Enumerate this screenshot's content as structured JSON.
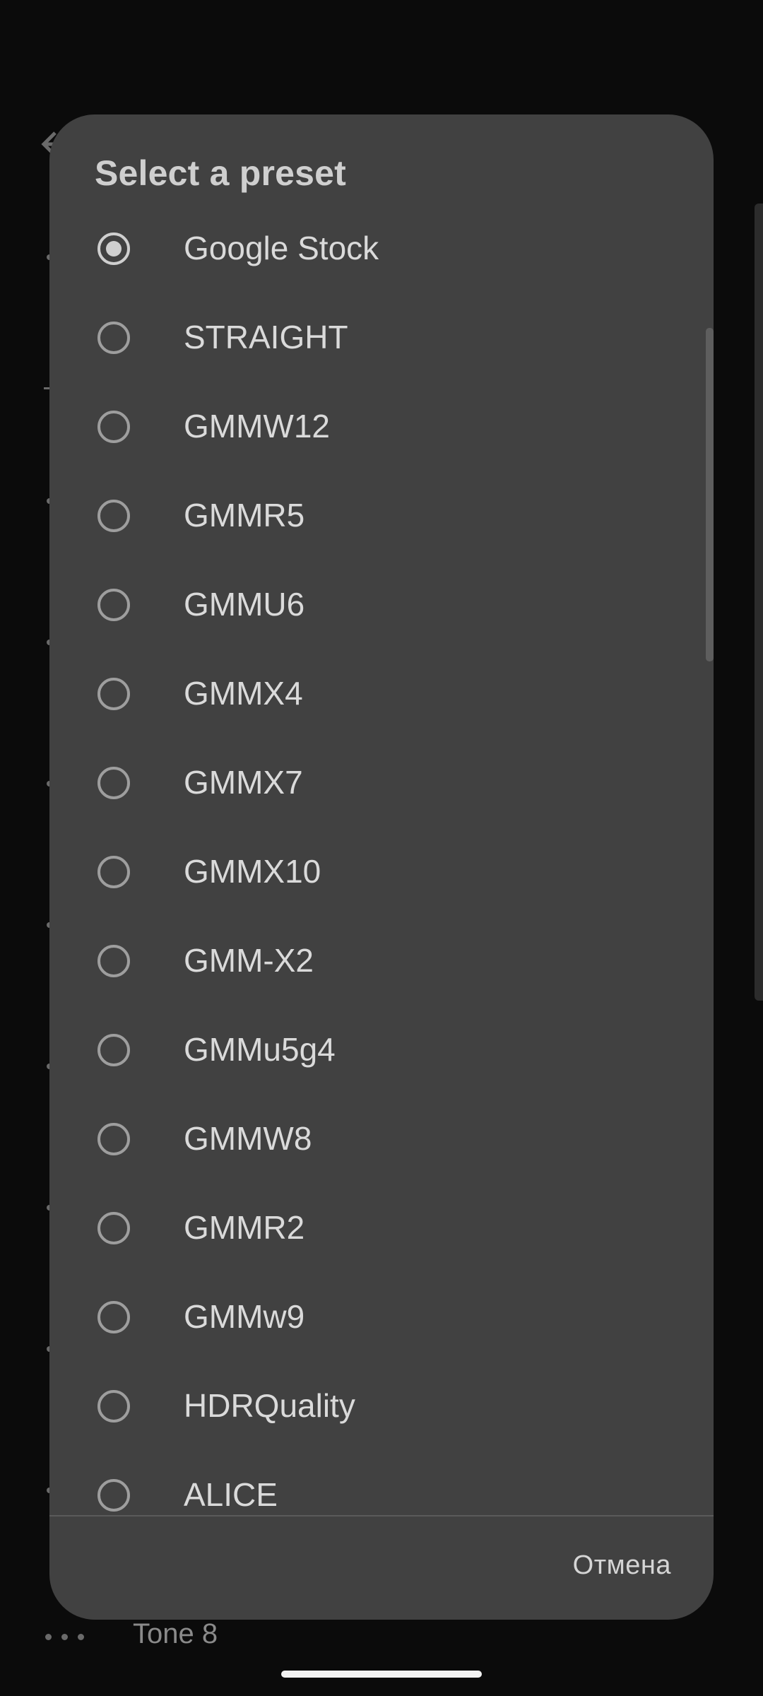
{
  "dialog": {
    "title": "Select a preset",
    "selected": "Google Stock",
    "options": [
      {
        "label": "Google Stock",
        "checked": true
      },
      {
        "label": "STRAIGHT",
        "checked": false
      },
      {
        "label": "GMMW12",
        "checked": false
      },
      {
        "label": "GMMR5",
        "checked": false
      },
      {
        "label": "GMMU6",
        "checked": false
      },
      {
        "label": "GMMX4",
        "checked": false
      },
      {
        "label": "GMMX7",
        "checked": false
      },
      {
        "label": "GMMX10",
        "checked": false
      },
      {
        "label": "GMM-X2",
        "checked": false
      },
      {
        "label": "GMMu5g4",
        "checked": false
      },
      {
        "label": "GMMW8",
        "checked": false
      },
      {
        "label": "GMMR2",
        "checked": false
      },
      {
        "label": "GMMw9",
        "checked": false
      },
      {
        "label": "HDRQuality",
        "checked": false
      },
      {
        "label": "ALICE",
        "checked": false
      }
    ],
    "cancel_label": "Отмена"
  },
  "background": {
    "bottom_item_label": "Tone 8",
    "back_icon": "arrow-left-icon",
    "more_icon": "more-dots-icon"
  },
  "colors": {
    "dialog_bg": "#414141",
    "screen_bg": "#0b0b0b",
    "text": "#dadada"
  }
}
